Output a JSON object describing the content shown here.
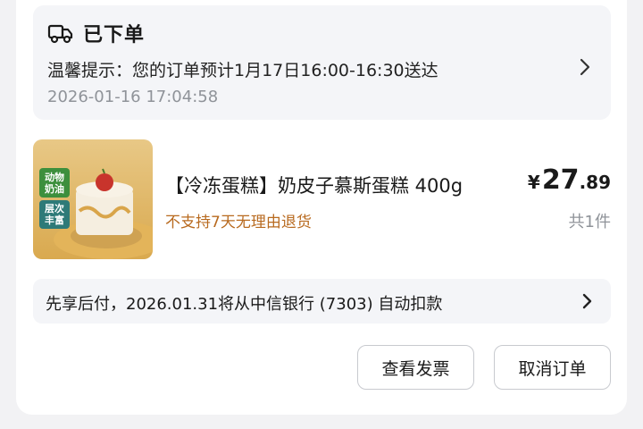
{
  "status": {
    "icon": "delivery-truck-icon",
    "title": "已下单",
    "tip": "温馨提示：您的订单预计1月17日16:00-16:30送达",
    "time": "2026-01-16 17:04:58"
  },
  "product": {
    "image_tags": [
      "动物奶油",
      "层次丰富"
    ],
    "name": "【冷冻蛋糕】奶皮子慕斯蛋糕 400g",
    "note": "不支持7天无理由退货",
    "price_symbol": "¥",
    "price_int": "27",
    "price_dec": ".89",
    "quantity": "共1件"
  },
  "payment": {
    "text": "先享后付，2026.01.31将从中信银行 (7303) 自动扣款"
  },
  "actions": {
    "invoice_label": "查看发票",
    "cancel_label": "取消订单"
  },
  "colors": {
    "note": "#b86a1f",
    "badge_green": "#3d8f3d",
    "panel_bg": "#f4f5f8"
  }
}
